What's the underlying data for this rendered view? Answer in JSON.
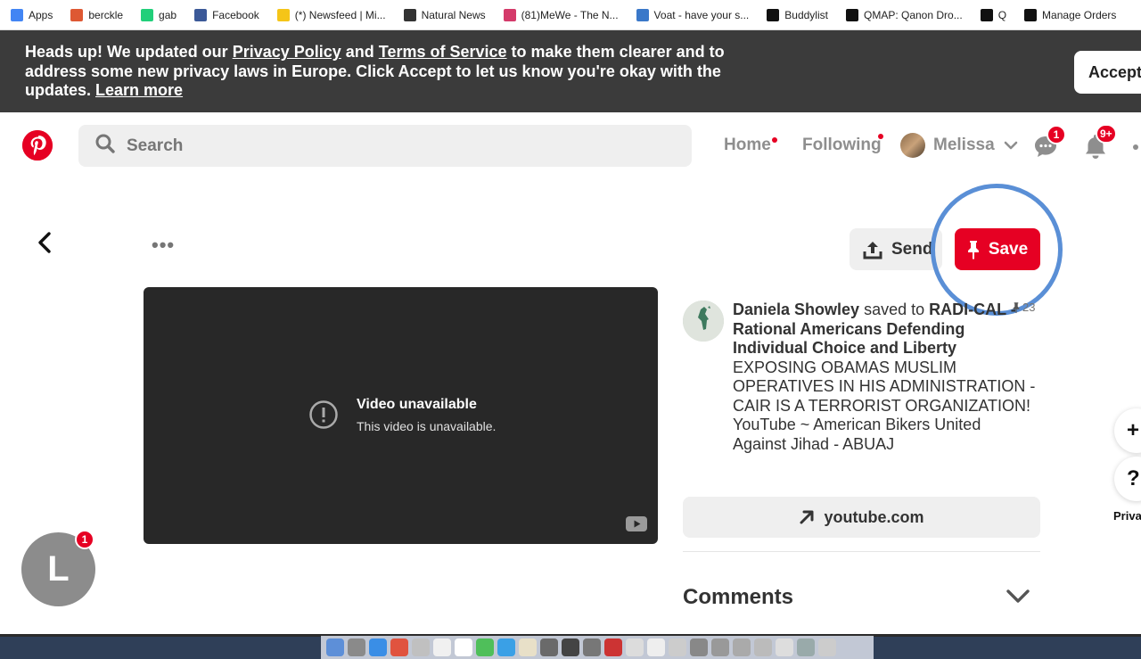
{
  "bookmarks": [
    {
      "label": "Apps",
      "icon": "apps-grid-icon",
      "color": "#4285f4"
    },
    {
      "label": "berckle",
      "icon": "duckduckgo-icon",
      "color": "#de5833"
    },
    {
      "label": "gab",
      "icon": "gab-icon",
      "color": "#21cf7a"
    },
    {
      "label": "Facebook",
      "icon": "facebook-icon",
      "color": "#3b5998"
    },
    {
      "label": "(*) Newsfeed | Mi...",
      "icon": "lightbulb-icon",
      "color": "#f5c518"
    },
    {
      "label": "Natural News",
      "icon": "natural-news-icon",
      "color": "#333333"
    },
    {
      "label": "(81)MeWe - The N...",
      "icon": "mewe-icon",
      "color": "#d43a6a"
    },
    {
      "label": "Voat - have your s...",
      "icon": "voat-icon",
      "color": "#3a78c9"
    },
    {
      "label": "Buddylist",
      "icon": "buddylist-icon",
      "color": "#111111"
    },
    {
      "label": "QMAP: Qanon Dro...",
      "icon": "qmap-icon",
      "color": "#111111"
    },
    {
      "label": "Q",
      "icon": "q-icon",
      "color": "#111111"
    },
    {
      "label": "Manage Orders",
      "icon": "amazon-icon",
      "color": "#111111"
    }
  ],
  "banner": {
    "part1": "Heads up! We updated our ",
    "privacy_link": "Privacy Policy",
    "part2": " and ",
    "terms_link": "Terms of Service",
    "part3": " to make them clearer and to address some new privacy laws in Europe. Click Accept to let us know you're okay with the updates. ",
    "learn_link": "Learn more",
    "accept_label": "Accept"
  },
  "header": {
    "search_placeholder": "Search",
    "home_label": "Home",
    "following_label": "Following",
    "user_name": "Melissa",
    "messages_badge": "1",
    "notifications_badge": "9+"
  },
  "toolbar": {
    "more_label": "•••",
    "send_label": "Send",
    "save_label": "Save"
  },
  "video": {
    "title": "Video unavailable",
    "subtitle": "This video is unavailable."
  },
  "pin": {
    "pinner_name": "Daniela Showley",
    "saved_to": " saved to ",
    "board_name": "RADI-CAL - Rational Americans Defending Individual Choice and Liberty",
    "description": "EXPOSING OBAMAS MUSLIM OPERATIVES IN HIS ADMINISTRATION - CAIR IS A TERRORIST ORGANIZATION! YouTube ~ American Bikers United Against Jihad - ABUAJ",
    "save_count": "23",
    "link_label": "youtube.com",
    "comments_label": "Comments"
  },
  "floating": {
    "plus_label": "+",
    "help_label": "?",
    "privacy_label": "Privacy"
  },
  "user": {
    "initial": "L",
    "badge": "1"
  },
  "colors": {
    "brand_red": "#e60023",
    "banner_bg": "#3b3b3b",
    "highlight_ring": "#5a8fd6"
  }
}
